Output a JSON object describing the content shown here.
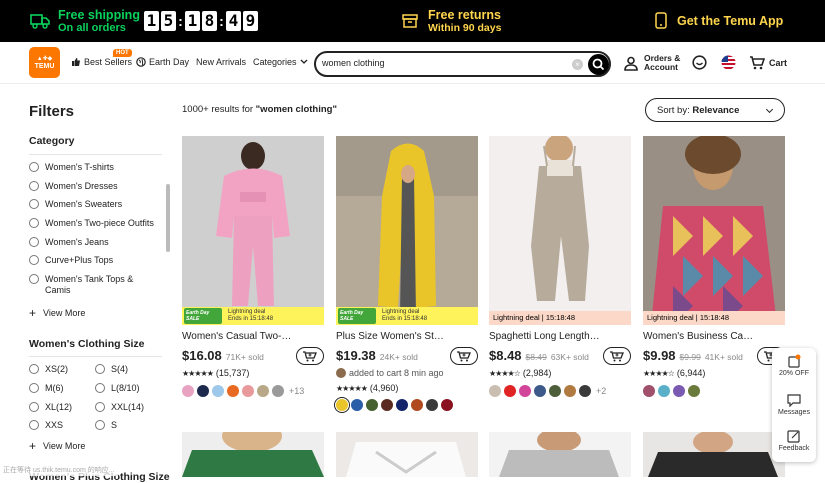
{
  "promo": {
    "shipping_title": "Free shipping",
    "shipping_sub": "On all orders",
    "timer": [
      "1",
      "5",
      "1",
      "8",
      "4",
      "9"
    ],
    "returns_title": "Free returns",
    "returns_sub": "Within 90 days",
    "app": "Get the Temu App"
  },
  "header": {
    "logo": "TEMU",
    "nav": [
      "Best Sellers",
      "Earth Day",
      "New Arrivals",
      "Categories"
    ],
    "hot_badge": "HOT",
    "search_value": "women clothing",
    "orders": "Orders &",
    "account": "Account",
    "cart": "Cart"
  },
  "sidebar": {
    "title": "Filters",
    "category_heading": "Category",
    "categories": [
      "Women's T-shirts",
      "Women's Dresses",
      "Women's Sweaters",
      "Women's Two-piece Outfits",
      "Women's Jeans",
      "Curve+Plus Tops",
      "Women's Tank Tops & Camis"
    ],
    "view_more": "View More",
    "size_heading": "Women's Clothing Size",
    "sizes": [
      "XS(2)",
      "S(4)",
      "M(6)",
      "L(8/10)",
      "XL(12)",
      "XXL(14)",
      "XXS",
      "S"
    ],
    "plus_heading": "Women's Plus Clothing Size"
  },
  "main": {
    "results_prefix": "1000+ results for ",
    "results_query": "\"women clothing\"",
    "sort_label": "Sort by: ",
    "sort_value": "Relevance"
  },
  "products": [
    {
      "title": "Women's Casual Two-Piece Se...",
      "price": "$16.08",
      "old": "",
      "sold": "71K+ sold",
      "stars": "★★★★★",
      "reviews": "(15,737)",
      "badge": "Lightning deal",
      "badge_time": "Ends in 15:18:48",
      "earth": "Earth Day SALE",
      "more": "+13"
    },
    {
      "title": "Plus Size Women's Stylish Hoo...",
      "price": "$19.38",
      "old": "",
      "sold": "24K+ sold",
      "added": "added to cart 8 min ago",
      "stars": "★★★★★",
      "reviews": "(4,960)",
      "badge": "Lightning deal",
      "badge_time": "Ends in 15:18:48",
      "earth": "Earth Day SALE",
      "more": ""
    },
    {
      "title": "Spaghetti Long Length Pocket...",
      "price": "$8.48",
      "old": "$8.49",
      "sold": "63K+ sold",
      "stars": "★★★★☆",
      "reviews": "(2,984)",
      "badge": "Lightning deal | 15:18:48",
      "more": "+2"
    },
    {
      "title": "Women's Business Casual Zipp...",
      "price": "$9.98",
      "old": "$9.99",
      "sold": "41K+ sold",
      "stars": "★★★★☆",
      "reviews": "(6,944)",
      "badge": "Lightning deal | 15:18:48",
      "more": ""
    }
  ],
  "floating": {
    "off": "20% OFF",
    "messages": "Messages",
    "feedback": "Feedback"
  },
  "status_url": "正在等待 us.thik.temu.com 的响应..."
}
